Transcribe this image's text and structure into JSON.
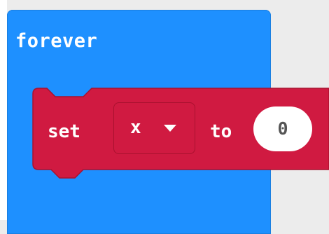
{
  "workspace": {
    "background_color": "#ececec"
  },
  "forever_block": {
    "label": "forever",
    "color": "#1e90ff"
  },
  "set_block": {
    "set_label": "set",
    "variable": "x",
    "dropdown_icon": "caret-down-icon",
    "to_label": "to",
    "value": "0",
    "color": "#d01a41"
  }
}
